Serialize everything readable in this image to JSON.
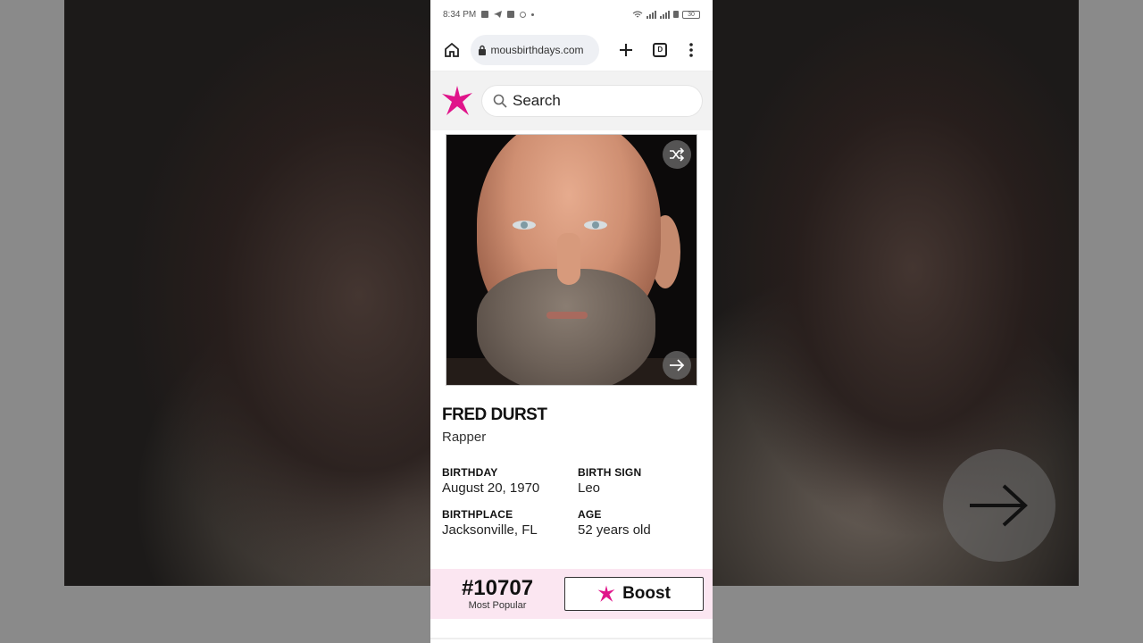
{
  "status_bar": {
    "time": "8:34 PM",
    "battery": "30"
  },
  "browser": {
    "url": "mousbirthdays.com",
    "tab_count": "D"
  },
  "site": {
    "search_placeholder": "Search"
  },
  "profile": {
    "name": "FRED DURST",
    "profession": "Rapper",
    "fields": [
      {
        "label": "BIRTHDAY",
        "value": "August 20, 1970"
      },
      {
        "label": "BIRTH SIGN",
        "value": "Leo"
      },
      {
        "label": "BIRTHPLACE",
        "value": "Jacksonville, FL"
      },
      {
        "label": "AGE",
        "value": "52 years old"
      }
    ]
  },
  "ranking": {
    "rank": "#10707",
    "rank_label": "Most Popular",
    "boost_label": "Boost"
  },
  "colors": {
    "brand_star": "#e0148a",
    "rank_bg": "#fbe6f1"
  }
}
